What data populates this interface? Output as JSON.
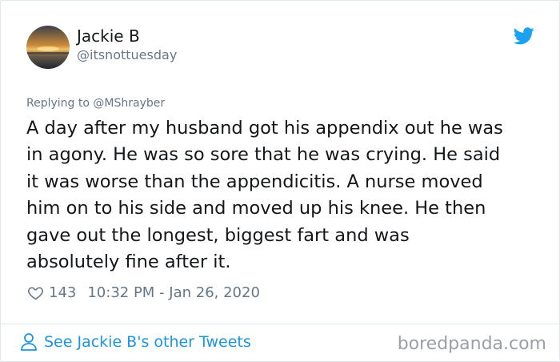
{
  "author": {
    "name": "Jackie B",
    "handle": "@itsnottuesday",
    "avatar_icon": "sunset-avatar"
  },
  "reply": {
    "prefix": "Replying to ",
    "to": "@MShrayber"
  },
  "tweet": {
    "text": "A day after my husband got his appendix out he was\nin agony. He was so sore that he was crying. He said\nit was worse than the appendicitis. A nurse moved\nhim on to his side and moved up his knee. He then\ngave out the longest, biggest fart and was\nabsolutely fine after it.",
    "likes": "143",
    "timestamp": "10:32 PM - Jan 26, 2020"
  },
  "footer": {
    "see_more": "See Jackie B's other Tweets",
    "watermark": "boredpanda.com"
  },
  "colors": {
    "link": "#1b95e0",
    "muted": "#657786",
    "twitter_blue": "#1da1f2"
  }
}
